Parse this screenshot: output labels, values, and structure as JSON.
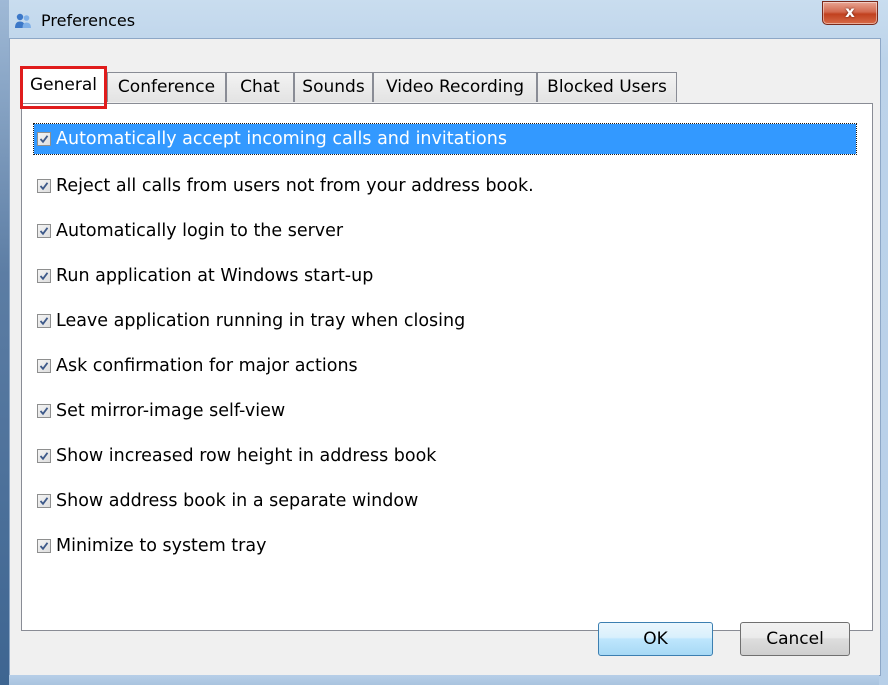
{
  "window": {
    "title": "Preferences",
    "close_label": "x"
  },
  "tabs": [
    {
      "label": "General",
      "active": true
    },
    {
      "label": "Conference",
      "active": false
    },
    {
      "label": "Chat",
      "active": false
    },
    {
      "label": "Sounds",
      "active": false
    },
    {
      "label": "Video Recording",
      "active": false
    },
    {
      "label": "Blocked Users",
      "active": false
    }
  ],
  "options": [
    {
      "label": "Automatically accept incoming calls and invitations",
      "checked": true,
      "selected": true
    },
    {
      "label": "Reject all calls from users not from your address book.",
      "checked": true,
      "selected": false
    },
    {
      "label": "Automatically login to the server",
      "checked": true,
      "selected": false
    },
    {
      "label": "Run application at Windows start-up",
      "checked": true,
      "selected": false
    },
    {
      "label": "Leave application running in tray when closing",
      "checked": true,
      "selected": false
    },
    {
      "label": "Ask confirmation for major actions",
      "checked": true,
      "selected": false
    },
    {
      "label": "Set mirror-image self-view",
      "checked": true,
      "selected": false
    },
    {
      "label": "Show increased row height in address book",
      "checked": true,
      "selected": false
    },
    {
      "label": "Show address book in a separate window",
      "checked": true,
      "selected": false
    },
    {
      "label": "Minimize to system tray",
      "checked": true,
      "selected": false
    }
  ],
  "buttons": {
    "ok_label": "OK",
    "cancel_label": "Cancel"
  },
  "colors": {
    "selection": "#3399ff",
    "highlight_box": "#e01c1c",
    "close_button": "#c1411f"
  },
  "icons": {
    "app": "users-icon",
    "close": "close-icon",
    "check": "checkmark-icon"
  }
}
